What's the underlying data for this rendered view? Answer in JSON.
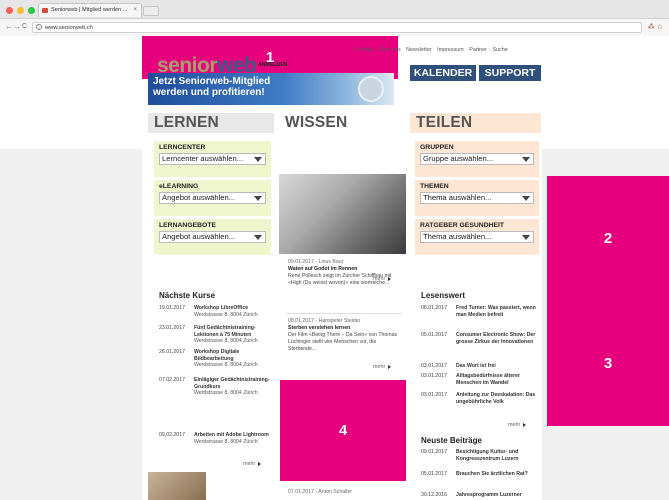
{
  "browser": {
    "tab_title": "Seniorweb | Mitglied werden ...",
    "tab_close": "×",
    "url": "www.seniorweb.ch",
    "back": "←",
    "forward": "→",
    "reload": "C",
    "info": "i",
    "toolbar_icons": "⁂ ☆"
  },
  "annotations": [
    "1",
    "2",
    "3",
    "4"
  ],
  "header": {
    "topnav": [
      "Kontakt",
      "Über uns",
      "Newsletter",
      "Impressum",
      "Partner",
      "Suche"
    ],
    "logo_a": "senior",
    "logo_b": "web",
    "login": "ANMELDEN",
    "kalender": "KALENDER",
    "support": "SUPPORT",
    "promo_line1": "Jetzt Seniorweb-Mitglied",
    "promo_line2": "werden und profitieren!"
  },
  "columns": {
    "lernen": "LERNEN",
    "wissen": "WISSEN",
    "teilen": "TEILEN"
  },
  "lernen_boxes": [
    {
      "title": "LERNCENTER",
      "value": "Lerncenter auswählen..."
    },
    {
      "title": "eLEARNING",
      "value": "Angebot auswählen..."
    },
    {
      "title": "LERNANGEBOTE",
      "value": "Angebot auswählen..."
    }
  ],
  "teilen_boxes": [
    {
      "title": "GRUPPEN",
      "value": "Gruppe auswählen..."
    },
    {
      "title": "THEMEN",
      "value": "Thema auswählen..."
    },
    {
      "title": "RATGEBER GESUNDHEIT",
      "value": "Thema auswählen..."
    }
  ],
  "kurse": {
    "title": "Nächste Kurse",
    "items": [
      {
        "date": "19.01.2017",
        "title": "Workshop LibreOffice",
        "sub": "Werdstrasse 8, 8004 Zürich"
      },
      {
        "date": "23.01.2017",
        "title": "Fünf Gedächtnistraining-Lektionen à 75 Minuten",
        "sub": "Werdstrasse 8, 8004 Zürich"
      },
      {
        "date": "26.01.2017",
        "title": "Workshop Digitale Bildbearbeitung",
        "sub": "Werdstrasse 8, 8004 Zürich"
      },
      {
        "date": "07.02.2017",
        "title": "Einlägiger Gedächtnistraining-Grundkurs",
        "sub": "Werdstrasse 8, 8004 Zürich"
      },
      {
        "date": "09.02.2017",
        "title": "Arbeiten mit Adobe Lightroom",
        "sub": "Werdstrasse 8, 8004 Zürich"
      }
    ],
    "more": "mehr"
  },
  "wissen": {
    "articles": [
      {
        "meta": "09.01.2017 - Linus Baur",
        "title": "Waten auf Godot im Rennen",
        "text": "René Pollesch zeigt im Zürcher Schiffbau mit «High (Du weisst wovon)» eine wortreiche...",
        "more": "mehr"
      },
      {
        "meta": "08.01.2017 - Hanspeter Steider",
        "title": "Sterben verstehen lernen",
        "text": "Der Film «Being There – Da Sein» von Thomas Lüchinger stellt vier Menschen vor, die Sterbende...",
        "more": "mehr"
      },
      {
        "meta": "07.01.2017 - Anton Schaller",
        "title": "",
        "text": "",
        "more": ""
      }
    ]
  },
  "lesenswert": {
    "title": "Lesenswert",
    "items": [
      {
        "date": "08.01.2017",
        "title": "Fred Turner: Was passiert, wenn man Medien befreit"
      },
      {
        "date": "05.01.2017",
        "title": "Consumer Electronic Show: Der grosse Zirkus der Innovationen"
      },
      {
        "date": "03.01.2017",
        "title": "Das Wort ist frei"
      },
      {
        "date": "03.01.2017",
        "title": "Alltagsbedürfnisse älterer Menschen im Wandel"
      },
      {
        "date": "03.01.2017",
        "title": "Anleitung zur Deeskalation: Das ungebührliche Volk"
      }
    ],
    "more": "mehr"
  },
  "neuste": {
    "title": "Neuste Beiträge",
    "items": [
      {
        "date": "09.01.2017",
        "title": "Besichtigung Kultur- und Kongresszentrum Luzern"
      },
      {
        "date": "05.01.2017",
        "title": "Brauchen Sie ärztlichen Rat?"
      },
      {
        "date": "30.12.2016",
        "title": "Jahresprogramm Luzerner"
      }
    ]
  },
  "colors": {
    "annotation": "#e7007e",
    "brand_blue": "#2f4f7d",
    "lernen_bg": "#eff5cc",
    "teilen_bg": "#fde6d3"
  }
}
